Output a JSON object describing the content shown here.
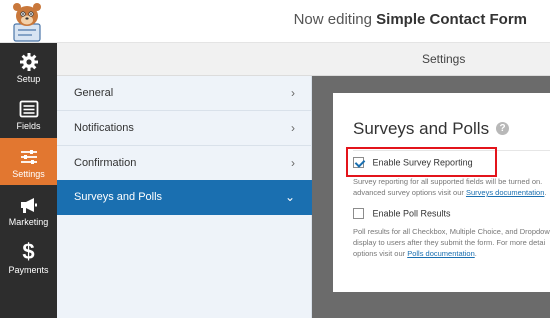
{
  "header": {
    "editing_prefix": "Now editing",
    "form_name": "Simple Contact Form"
  },
  "leftnav": {
    "items": [
      {
        "label": "Setup",
        "icon": "gear-icon"
      },
      {
        "label": "Fields",
        "icon": "fields-list-icon"
      },
      {
        "label": "Settings",
        "icon": "sliders-icon",
        "active": true
      },
      {
        "label": "Marketing",
        "icon": "megaphone-icon"
      },
      {
        "label": "Payments",
        "icon": "dollar-icon"
      }
    ]
  },
  "settings_header": {
    "title": "Settings"
  },
  "menu": {
    "items": [
      {
        "label": "General"
      },
      {
        "label": "Notifications"
      },
      {
        "label": "Confirmation"
      },
      {
        "label": "Surveys and Polls",
        "active": true
      }
    ]
  },
  "panel": {
    "title": "Surveys and Polls",
    "survey_checkbox": {
      "label": "Enable Survey Reporting",
      "checked": true
    },
    "survey_desc_line1": "Survey reporting for all supported fields will be turned on.",
    "survey_desc_line2_prefix": "advanced survey options visit our ",
    "survey_desc_link": "Surveys documentation",
    "survey_desc_suffix": ".",
    "poll_checkbox": {
      "label": "Enable Poll Results",
      "checked": false
    },
    "poll_desc_line1": "Poll results for all Checkbox, Multiple Choice, and Dropdown",
    "poll_desc_line2": "display to users after they submit the form. For more detai",
    "poll_desc_line3_prefix": "options visit our ",
    "poll_desc_link": "Polls documentation",
    "poll_desc_suffix": "."
  },
  "colors": {
    "accent_orange": "#e27730",
    "active_blue": "#1a6fb0",
    "nav_dark": "#2d2d2d",
    "highlight_red": "#e3141b"
  }
}
